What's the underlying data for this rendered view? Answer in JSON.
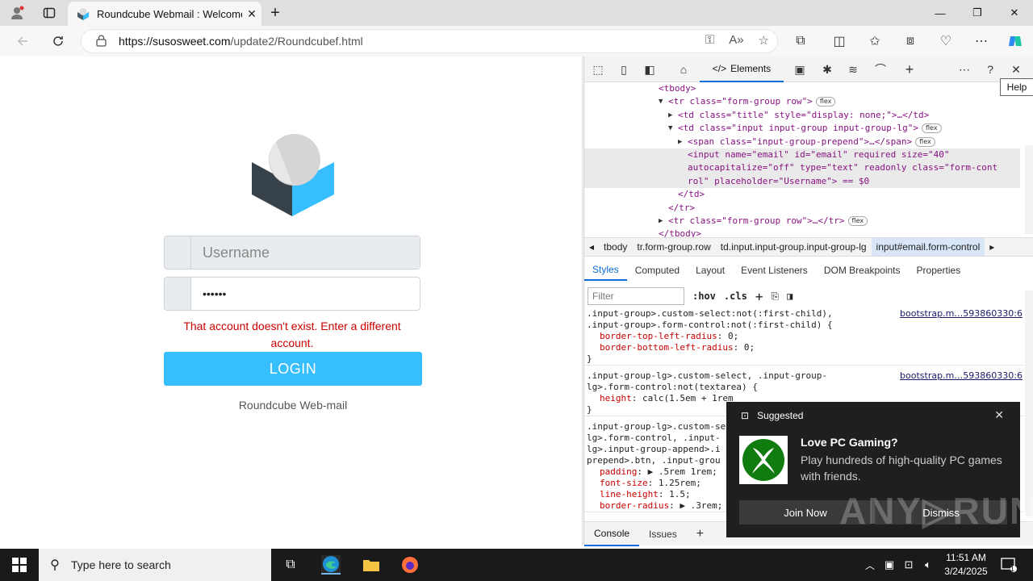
{
  "browser": {
    "tab_title": "Roundcube Webmail : Welcome",
    "tab_close": "✕",
    "new_tab": "+",
    "url_domain": "https://susosweet.com",
    "url_path": "/update2/Roundcubef.html",
    "win_min": "—",
    "win_max": "❐",
    "win_close": "✕"
  },
  "page": {
    "username_placeholder": "Username",
    "password_value": "••••••",
    "error_text": "That account doesn't exist. Enter a different account.",
    "login_label": "LOGIN",
    "brand_text": "Roundcube Web-mail"
  },
  "devtools": {
    "elements_tab": "Elements",
    "help_tooltip": "Help",
    "dom_lines": [
      {
        "indent": 92,
        "text": "<tbody>"
      },
      {
        "indent": 104,
        "text": "<tr class=\"form-group row\">"
      },
      {
        "indent": 116,
        "text": "<td class=\"title\" style=\"display: none;\">…</td>"
      },
      {
        "indent": 116,
        "text": "<td class=\"input input-group input-group-lg\">"
      },
      {
        "indent": 128,
        "text": "<span class=\"input-group-prepend\">…</span>"
      },
      {
        "indent": 128,
        "text": "<input name=\"email\" id=\"email\" required size=\"40\""
      },
      {
        "indent": 128,
        "text": "autocapitalize=\"off\" type=\"text\" readonly class=\"form-cont"
      },
      {
        "indent": 128,
        "text": "rol\" placeholder=\"Username\"> == $0"
      },
      {
        "indent": 116,
        "text": "</td>"
      },
      {
        "indent": 104,
        "text": "</tr>"
      },
      {
        "indent": 104,
        "text": "<tr class=\"form-group row\">…</tr>"
      },
      {
        "indent": 92,
        "text": "</tbody>"
      }
    ],
    "flex_pill": "flex",
    "breadcrumbs": [
      "tbody",
      "tr.form-group.row",
      "td.input.input-group.input-group-lg",
      "input#email.form-control"
    ],
    "style_tabs": [
      "Styles",
      "Computed",
      "Layout",
      "Event Listeners",
      "DOM Breakpoints",
      "Properties"
    ],
    "filter_placeholder": "Filter",
    "hov": ":hov",
    "cls": ".cls",
    "rules": [
      {
        "selector": ".input-group>.custom-select:not(:first-child),\n.input-group>.form-control:not(:first-child) {",
        "source": "bootstrap.m…593860330:6",
        "decls": [
          "border-top-left-radius: 0;",
          "border-bottom-left-radius: 0;"
        ]
      },
      {
        "selector": ".input-group-lg>.custom-select, .input-group-\nlg>.form-control:not(textarea) {",
        "source": "bootstrap.m…593860330:6",
        "decls": [
          "height: calc(1.5em + 1rem"
        ]
      },
      {
        "selector": ".input-group-lg>.custom-sel\nlg>.form-control, .input-\nlg>.input-group-append>.i\nprepend>.btn, .input-grou",
        "source": "",
        "decls": [
          "padding: ▶ .5rem 1rem;",
          "font-size: 1.25rem;",
          "line-height: 1.5;",
          "border-radius: ▶ .3rem;"
        ]
      }
    ],
    "console_tabs": [
      "Console",
      "Issues"
    ]
  },
  "toast": {
    "header": "Suggested",
    "title": "Love PC Gaming?",
    "body": "Play hundreds of high-quality PC games with friends.",
    "join": "Join Now",
    "dismiss": "Dismiss"
  },
  "watermark": "ANY▷RUN",
  "taskbar": {
    "search_placeholder": "Type here to search",
    "time": "11:51 AM",
    "date": "3/24/2025",
    "notif_count": "1"
  }
}
